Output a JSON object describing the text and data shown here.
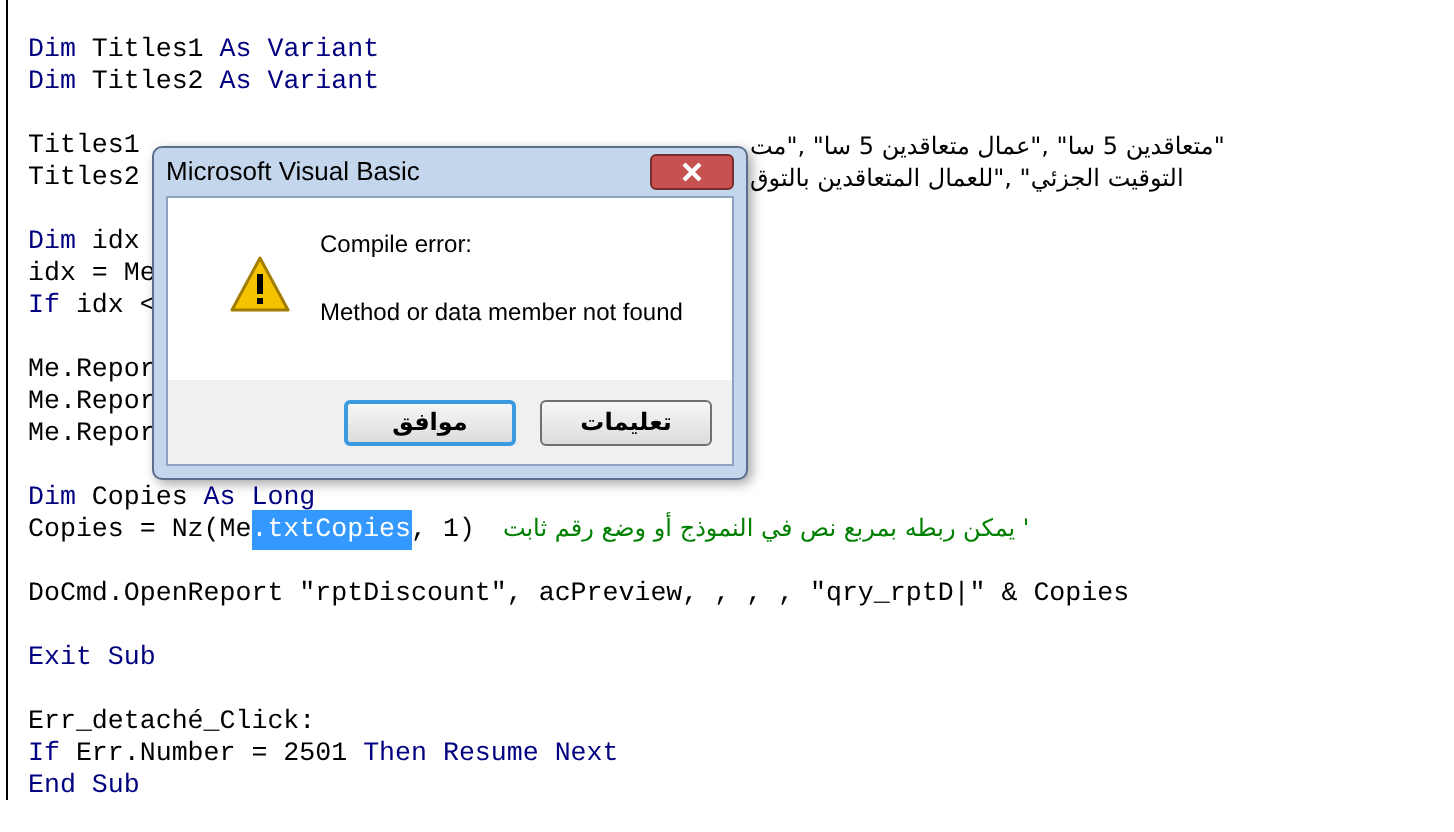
{
  "code": {
    "blocks": [
      [
        {
          "tokens": [
            {
              "kind": "keyword",
              "text": "Dim"
            },
            {
              "kind": "plain",
              "text": " Titles1 "
            },
            {
              "kind": "keyword",
              "text": "As Variant"
            }
          ]
        },
        {
          "tokens": [
            {
              "kind": "keyword",
              "text": "Dim"
            },
            {
              "kind": "plain",
              "text": " Titles2 "
            },
            {
              "kind": "keyword",
              "text": "As Variant"
            }
          ]
        }
      ],
      [
        {
          "tokens": [
            {
              "kind": "plain",
              "text": "Titles1"
            }
          ],
          "right": "\"متعاقدين 5 سا\" ,\"عمال متعاقدين 5 سا\" ,\"مت"
        },
        {
          "tokens": [
            {
              "kind": "plain",
              "text": "Titles2"
            }
          ],
          "right": "التوقيت الجزئي\" ,\"للعمال المتعاقدين بالتوق"
        }
      ],
      [
        {
          "tokens": [
            {
              "kind": "keyword",
              "text": "Dim"
            },
            {
              "kind": "plain",
              "text": " idx"
            }
          ]
        },
        {
          "tokens": [
            {
              "kind": "plain",
              "text": "idx = Me"
            }
          ]
        },
        {
          "tokens": [
            {
              "kind": "keyword",
              "text": "If"
            },
            {
              "kind": "plain",
              "text": " idx <"
            }
          ]
        }
      ],
      [
        {
          "tokens": [
            {
              "kind": "plain",
              "text": "Me.Repor"
            }
          ]
        },
        {
          "tokens": [
            {
              "kind": "plain",
              "text": "Me.Repor"
            }
          ]
        },
        {
          "tokens": [
            {
              "kind": "plain",
              "text": "Me.Repor"
            }
          ]
        }
      ],
      [
        {
          "tokens": [
            {
              "kind": "keyword",
              "text": "Dim"
            },
            {
              "kind": "plain",
              "text": " Copies "
            },
            {
              "kind": "keyword",
              "text": "As Long"
            }
          ]
        },
        {
          "tokens": [
            {
              "kind": "plain",
              "text": "Copies = Nz(Me"
            },
            {
              "kind": "selected",
              "text": ".txtCopies"
            },
            {
              "kind": "plain",
              "text": ", 1)"
            },
            {
              "kind": "comment",
              "text": "' يمكن ربطه بمربع نص في النموذج أو وضع رقم ثابت"
            }
          ]
        }
      ],
      [
        {
          "tokens": [
            {
              "kind": "plain",
              "text": "DoCmd.OpenReport \"rptDiscount\", acPreview, , , , \"qry_rptD|\" & Copies"
            }
          ]
        }
      ],
      [
        {
          "tokens": [
            {
              "kind": "keyword",
              "text": "Exit Sub"
            }
          ]
        }
      ],
      [
        {
          "tokens": [
            {
              "kind": "plain",
              "text": "Err_detaché_Click:"
            }
          ]
        },
        {
          "tokens": [
            {
              "kind": "keyword",
              "text": "If"
            },
            {
              "kind": "plain",
              "text": " Err.Number = 2501 "
            },
            {
              "kind": "keyword",
              "text": "Then Resume Next"
            }
          ]
        },
        {
          "tokens": [
            {
              "kind": "keyword",
              "text": "End Sub"
            }
          ]
        }
      ]
    ]
  },
  "dialog": {
    "title": "Microsoft Visual Basic",
    "heading": "Compile error:",
    "message": "Method or data member not found",
    "buttons": [
      {
        "label": "تعليمات",
        "focused": false
      },
      {
        "label": "موافق",
        "focused": true
      }
    ]
  }
}
